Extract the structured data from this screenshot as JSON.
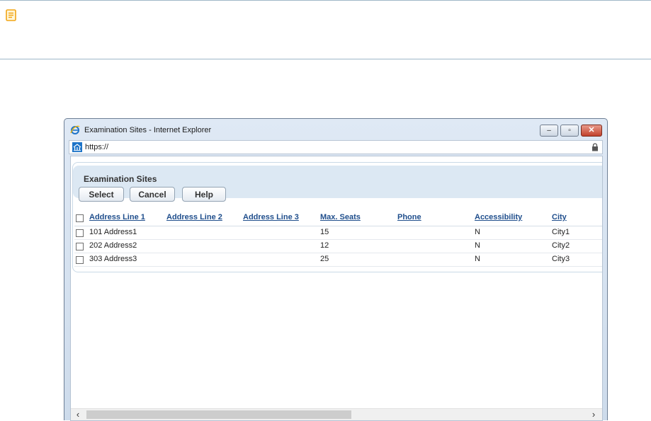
{
  "window": {
    "title": "Examination Sites - Internet Explorer",
    "url": "https://",
    "min_symbol": "–",
    "max_symbol": "▫",
    "close_symbol": "✕"
  },
  "panel": {
    "title": "Examination Sites",
    "buttons": {
      "select": "Select",
      "cancel": "Cancel",
      "help": "Help"
    }
  },
  "table": {
    "columns": [
      "Address Line 1",
      "Address Line 2",
      "Address Line 3",
      "Max. Seats",
      "Phone",
      "Accessibility",
      "City"
    ],
    "rows": [
      [
        "101 Address1",
        "",
        "",
        "15",
        "",
        "N",
        "City1"
      ],
      [
        "202 Address2",
        "",
        "",
        "12",
        "",
        "N",
        "City2"
      ],
      [
        "303 Address3",
        "",
        "",
        "25",
        "",
        "N",
        "City3"
      ]
    ]
  },
  "scroll": {
    "left": "‹",
    "right": "›"
  },
  "icons": {
    "note": "note-icon",
    "ie": "ie-logo-icon",
    "site": "site-icon",
    "lock": "lock-icon"
  },
  "colors": {
    "link": "#1f4e8c",
    "note": "#f2a516",
    "ie": "#1e74c8"
  }
}
